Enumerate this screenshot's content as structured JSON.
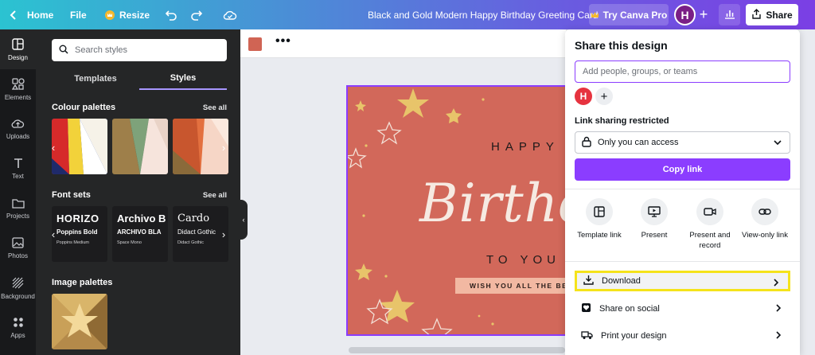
{
  "topbar": {
    "home_label": "Home",
    "file_label": "File",
    "resize_label": "Resize",
    "doc_title": "Black and Gold Modern Happy Birthday Greeting Card",
    "try_pro_label": "Try Canva Pro",
    "avatar_initial": "H",
    "share_label": "Share"
  },
  "rail": {
    "items": [
      {
        "label": "Design",
        "icon": "layout-icon"
      },
      {
        "label": "Elements",
        "icon": "shapes-icon"
      },
      {
        "label": "Uploads",
        "icon": "cloud-upload-icon"
      },
      {
        "label": "Text",
        "icon": "text-icon"
      },
      {
        "label": "Projects",
        "icon": "folder-icon"
      },
      {
        "label": "Photos",
        "icon": "image-icon"
      },
      {
        "label": "Background",
        "icon": "pattern-icon"
      },
      {
        "label": "Apps",
        "icon": "apps-icon"
      }
    ]
  },
  "panel": {
    "search_placeholder": "Search styles",
    "tabs": [
      "Templates",
      "Styles"
    ],
    "active_tab": "Styles",
    "colour_palettes_title": "Colour palettes",
    "font_sets_title": "Font sets",
    "image_palettes_title": "Image palettes",
    "see_all": "See all",
    "font_sets": [
      {
        "big": "HORIZO",
        "mid": "Poppins Bold",
        "small": "Poppins Medium"
      },
      {
        "big": "Archivo B",
        "mid": "ARCHIVO BLA",
        "small": "Space Mono"
      },
      {
        "big": "Cardo",
        "mid": "Didact Gothic",
        "small": "Didact Gothic"
      }
    ]
  },
  "card": {
    "happy": "HAPPY",
    "birthday": "Birthday",
    "to_you": "TO YOU",
    "ribbon": "WISH YOU ALL THE BEST"
  },
  "share": {
    "title": "Share this design",
    "people_placeholder": "Add people, groups, or teams",
    "member_initial": "H",
    "link_sharing": "Link sharing restricted",
    "access_value": "Only you can access",
    "copy_link": "Copy link",
    "options": [
      {
        "label": "Template link",
        "icon": "template-icon"
      },
      {
        "label": "Present",
        "icon": "present-icon"
      },
      {
        "label": "Present and\nrecord",
        "icon": "camera-icon"
      },
      {
        "label": "View-only link",
        "icon": "link-icon"
      }
    ],
    "rows": [
      {
        "label": "Download",
        "icon": "download-icon",
        "highlighted": true
      },
      {
        "label": "Share on social",
        "icon": "heart-icon"
      },
      {
        "label": "Print your design",
        "icon": "truck-icon"
      }
    ]
  },
  "colors": {
    "accent": "#8b3dff",
    "card_bg": "#d2685a",
    "highlight": "#f5e31b"
  }
}
